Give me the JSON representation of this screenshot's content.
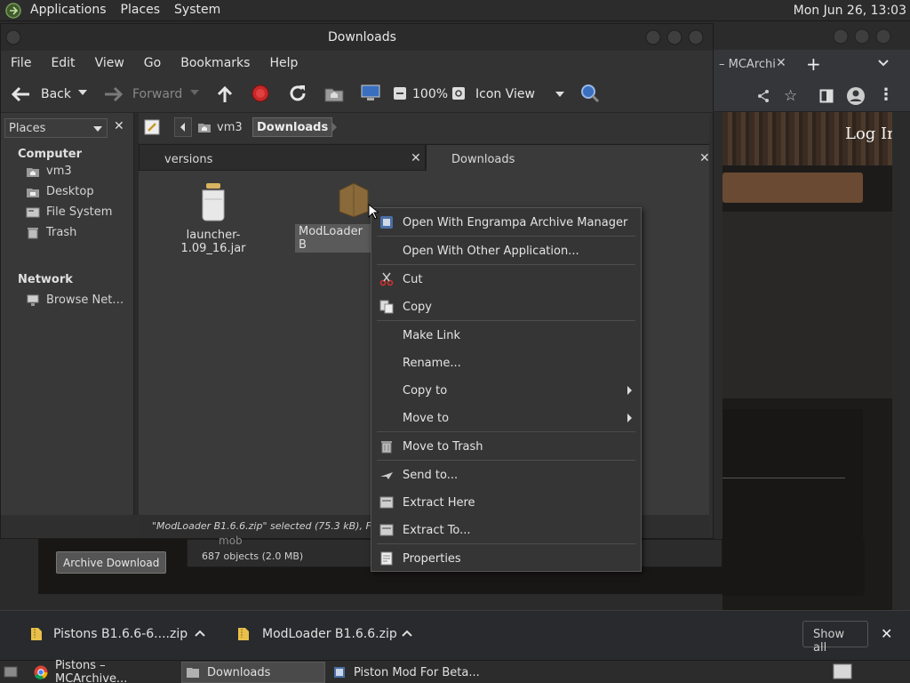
{
  "top_panel": {
    "menus": [
      "Applications",
      "Places",
      "System"
    ],
    "clock": "Mon Jun 26, 13:03"
  },
  "browser": {
    "tab_title": "– MCArchi",
    "login_label": "Log In",
    "archive_button": "Archive Download"
  },
  "file_manager": {
    "title": "Downloads",
    "menubar": [
      "File",
      "Edit",
      "View",
      "Go",
      "Bookmarks",
      "Help"
    ],
    "toolbar": {
      "back": "Back",
      "forward": "Forward",
      "zoom": "100%",
      "view_mode": "Icon View"
    },
    "sidebar": {
      "dropdown": "Places",
      "computer_header": "Computer",
      "computer_items": [
        "vm3",
        "Desktop",
        "File System",
        "Trash"
      ],
      "network_header": "Network",
      "network_items": [
        "Browse Net…"
      ]
    },
    "path": [
      "vm3",
      "Downloads"
    ],
    "tabs": [
      "versions",
      "Downloads"
    ],
    "files": [
      "launcher-1.09_16.jar",
      "ModLoader B"
    ],
    "status": "\"ModLoader B1.6.6.zip\" selected (75.3 kB), Free spa",
    "status2": "687 objects (2.0 MB)",
    "behind_item": "mob"
  },
  "context_menu": {
    "items": [
      "Open With Engrampa Archive Manager",
      "Open With Other Application...",
      "Cut",
      "Copy",
      "Make Link",
      "Rename...",
      "Copy to",
      "Move to",
      "Move to Trash",
      "Send to...",
      "Extract Here",
      "Extract To...",
      "Properties"
    ]
  },
  "downloads_shelf": {
    "items": [
      "Pistons B1.6.6-6....zip",
      "ModLoader B1.6.6.zip"
    ],
    "show_all": "Show all"
  },
  "taskbar": {
    "items": [
      "Pistons – MCArchive...",
      "Downloads",
      "Piston Mod For Beta..."
    ]
  },
  "colors": {
    "selection": "#5a5a5a",
    "accent_red": "#c62828",
    "folder_yellow": "#e8c04a"
  }
}
